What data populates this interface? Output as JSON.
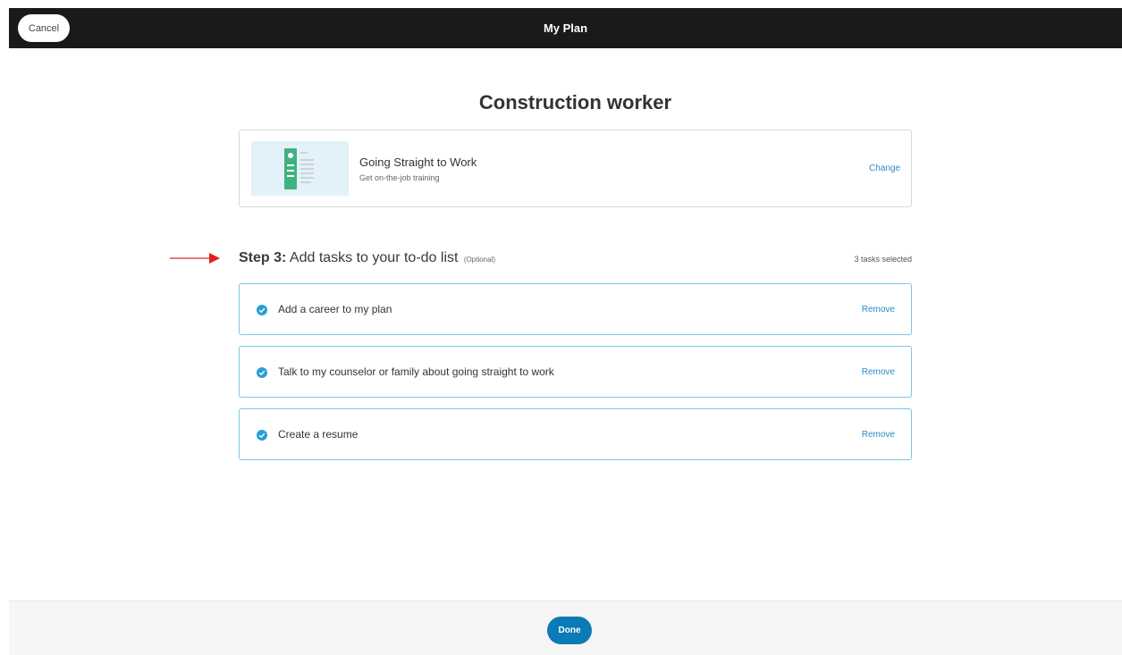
{
  "topbar": {
    "cancel_label": "Cancel",
    "title": "My Plan"
  },
  "career": {
    "title": "Construction worker"
  },
  "pathway": {
    "name": "Going Straight to Work",
    "subtitle": "Get on-the-job training",
    "change_label": "Change",
    "thumbnail_icon": "resume-document-icon"
  },
  "step": {
    "number_label": "Step 3:",
    "title": "Add tasks to your to-do list",
    "optional_label": "(Optional)",
    "tasks_selected": "3 tasks selected"
  },
  "tasks": [
    {
      "label": "Add a career to my plan",
      "remove_label": "Remove",
      "checked": true
    },
    {
      "label": "Talk to my counselor or family about going straight to work",
      "remove_label": "Remove",
      "checked": true
    },
    {
      "label": "Create a resume",
      "remove_label": "Remove",
      "checked": true
    }
  ],
  "footer": {
    "done_label": "Done"
  },
  "colors": {
    "topbar_bg": "#1a1a1a",
    "accent_link": "#2b8cc4",
    "check_blue": "#2a9fd6",
    "task_border": "#79c8e8",
    "done_button": "#0c7ab6",
    "annotation_arrow": "#e02020",
    "thumb_bg": "#e3f1f8",
    "thumb_green": "#3fb27f"
  }
}
